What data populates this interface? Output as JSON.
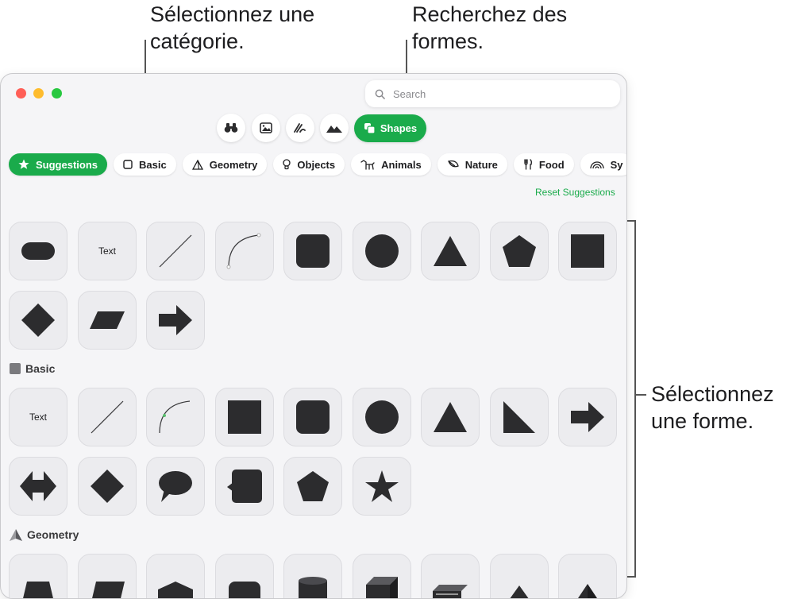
{
  "callouts": {
    "category_line1": "Sélectionnez une",
    "category_line2": "catégorie.",
    "search_line1": "Recherchez des",
    "search_line2": "formes.",
    "shape_line1": "Sélectionnez",
    "shape_line2": "une forme."
  },
  "search": {
    "placeholder": "Search"
  },
  "toolbar": {
    "shapes_label": "Shapes"
  },
  "categories": [
    {
      "label": "Suggestions",
      "icon": "star-icon",
      "active": true
    },
    {
      "label": "Basic",
      "icon": "square-icon"
    },
    {
      "label": "Geometry",
      "icon": "pyramid-icon"
    },
    {
      "label": "Objects",
      "icon": "lightbulb-icon"
    },
    {
      "label": "Animals",
      "icon": "dog-icon"
    },
    {
      "label": "Nature",
      "icon": "leaf-icon"
    },
    {
      "label": "Food",
      "icon": "fork-knife-icon"
    },
    {
      "label": "Sy",
      "icon": "rainbow-icon"
    }
  ],
  "reset_label": "Reset Suggestions",
  "tile_text_label": "Text",
  "sections": {
    "basic": "Basic",
    "geometry": "Geometry"
  },
  "accent_color": "#1aab4b",
  "shape_color": "#2c2c2e"
}
